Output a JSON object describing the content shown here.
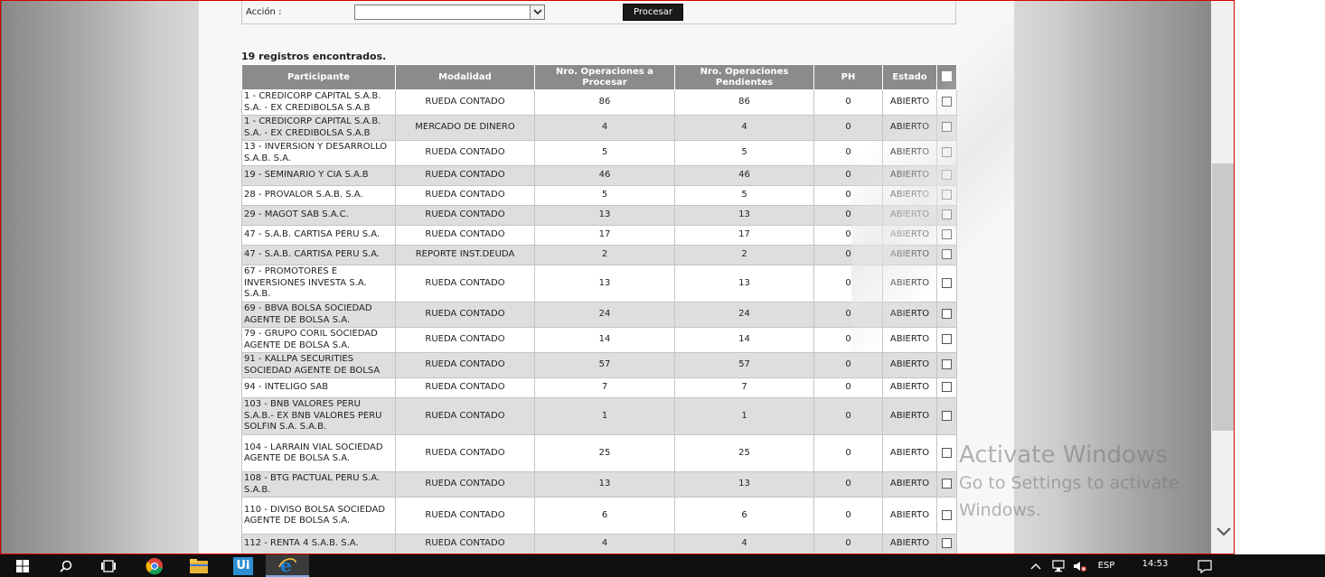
{
  "filter": {
    "accion_label": "Acción :",
    "accion_value": "",
    "procesar_label": "Procesar"
  },
  "results": {
    "count_text": "19 registros encontrados."
  },
  "table": {
    "headers": {
      "participante": "Participante",
      "modalidad": "Modalidad",
      "nro_procesar": "Nro. Operaciones a Procesar",
      "nro_pendientes": "Nro. Operaciones Pendientes",
      "ph": "PH",
      "estado": "Estado"
    },
    "rows": [
      {
        "participante": "1 - CREDICORP CAPITAL S.A.B. S.A. - EX CREDIBOLSA S.A.B",
        "modalidad": "RUEDA CONTADO",
        "procesar": "86",
        "pendientes": "86",
        "ph": "0",
        "estado": "ABIERTO"
      },
      {
        "participante": "1 - CREDICORP CAPITAL S.A.B. S.A. - EX CREDIBOLSA S.A.B",
        "modalidad": "MERCADO DE DINERO",
        "procesar": "4",
        "pendientes": "4",
        "ph": "0",
        "estado": "ABIERTO"
      },
      {
        "participante": "13 - INVERSION Y DESARROLLO S.A.B. S.A.",
        "modalidad": "RUEDA CONTADO",
        "procesar": "5",
        "pendientes": "5",
        "ph": "0",
        "estado": "ABIERTO"
      },
      {
        "participante": "19 - SEMINARIO Y CIA S.A.B",
        "modalidad": "RUEDA CONTADO",
        "procesar": "46",
        "pendientes": "46",
        "ph": "0",
        "estado": "ABIERTO"
      },
      {
        "participante": "28 - PROVALOR S.A.B. S.A.",
        "modalidad": "RUEDA CONTADO",
        "procesar": "5",
        "pendientes": "5",
        "ph": "0",
        "estado": "ABIERTO"
      },
      {
        "participante": "29 - MAGOT SAB S.A.C.",
        "modalidad": "RUEDA CONTADO",
        "procesar": "13",
        "pendientes": "13",
        "ph": "0",
        "estado": "ABIERTO"
      },
      {
        "participante": "47 - S.A.B. CARTISA PERU S.A.",
        "modalidad": "RUEDA CONTADO",
        "procesar": "17",
        "pendientes": "17",
        "ph": "0",
        "estado": "ABIERTO"
      },
      {
        "participante": "47 - S.A.B. CARTISA PERU S.A.",
        "modalidad": "REPORTE INST.DEUDA",
        "procesar": "2",
        "pendientes": "2",
        "ph": "0",
        "estado": "ABIERTO"
      },
      {
        "participante": "67 - PROMOTORES E INVERSIONES INVESTA S.A. S.A.B.",
        "modalidad": "RUEDA CONTADO",
        "procesar": "13",
        "pendientes": "13",
        "ph": "0",
        "estado": "ABIERTO"
      },
      {
        "participante": "69 - BBVA BOLSA SOCIEDAD AGENTE DE BOLSA S.A.",
        "modalidad": "RUEDA CONTADO",
        "procesar": "24",
        "pendientes": "24",
        "ph": "0",
        "estado": "ABIERTO"
      },
      {
        "participante": "79 - GRUPO CORIL SOCIEDAD AGENTE DE BOLSA S.A.",
        "modalidad": "RUEDA CONTADO",
        "procesar": "14",
        "pendientes": "14",
        "ph": "0",
        "estado": "ABIERTO"
      },
      {
        "participante": "91 - KALLPA SECURITIES SOCIEDAD AGENTE DE BOLSA",
        "modalidad": "RUEDA CONTADO",
        "procesar": "57",
        "pendientes": "57",
        "ph": "0",
        "estado": "ABIERTO"
      },
      {
        "participante": "94 - INTELIGO SAB",
        "modalidad": "RUEDA CONTADO",
        "procesar": "7",
        "pendientes": "7",
        "ph": "0",
        "estado": "ABIERTO"
      },
      {
        "participante": "103 - BNB VALORES PERU S.A.B.- EX BNB VALORES PERU SOLFIN S.A. S.A.B.",
        "modalidad": "RUEDA CONTADO",
        "procesar": "1",
        "pendientes": "1",
        "ph": "0",
        "estado": "ABIERTO"
      },
      {
        "participante": "104 - LARRAIN VIAL SOCIEDAD AGENTE DE BOLSA S.A.",
        "modalidad": "RUEDA CONTADO",
        "procesar": "25",
        "pendientes": "25",
        "ph": "0",
        "estado": "ABIERTO"
      },
      {
        "participante": "108 - BTG PACTUAL PERU S.A. S.A.B.",
        "modalidad": "RUEDA CONTADO",
        "procesar": "13",
        "pendientes": "13",
        "ph": "0",
        "estado": "ABIERTO"
      },
      {
        "participante": "110 - DIVISO BOLSA SOCIEDAD AGENTE DE BOLSA S.A.",
        "modalidad": "RUEDA CONTADO",
        "procesar": "6",
        "pendientes": "6",
        "ph": "0",
        "estado": "ABIERTO"
      },
      {
        "participante": "112 - RENTA 4 S.A.B. S.A.",
        "modalidad": "RUEDA CONTADO",
        "procesar": "4",
        "pendientes": "4",
        "ph": "0",
        "estado": "ABIERTO"
      }
    ]
  },
  "watermark": {
    "line1": "Activate Windows",
    "line2": "Go to Settings to activate Windows."
  },
  "taskbar": {
    "language": "ESP",
    "time": "14:53",
    "ui_app_label": "Ui",
    "icons": [
      "windows-start-icon",
      "search-icon",
      "task-view-icon",
      "chrome-icon",
      "file-explorer-icon",
      "uipath-icon",
      "internet-explorer-icon",
      "chevron-up-icon",
      "network-icon",
      "volume-muted-icon",
      "notification-icon"
    ]
  },
  "colors": {
    "header_bg": "#8b8b8b",
    "row_alt_bg": "#dedede",
    "button_bg": "#1a1a1a",
    "browser_border": "#d80000"
  }
}
